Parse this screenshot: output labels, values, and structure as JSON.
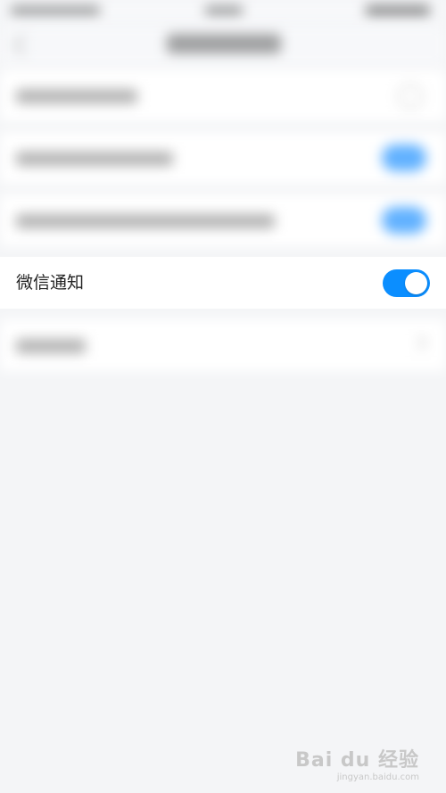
{
  "focus_item": {
    "label": "微信通知",
    "toggle_on": true
  },
  "watermark": {
    "main": "Bai du 经验",
    "sub": "jingyan.baidu.com"
  },
  "colors": {
    "accent": "#0b8eff",
    "background": "#f4f5f7",
    "row_background": "#ffffff"
  }
}
